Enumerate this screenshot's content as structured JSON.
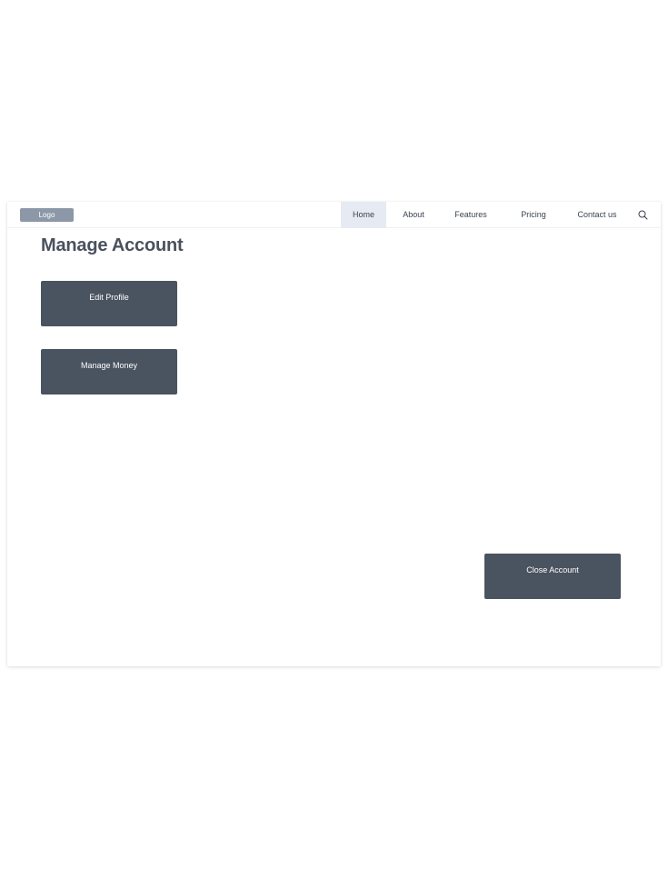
{
  "navbar": {
    "logo": "Logo",
    "items": [
      {
        "label": "Home",
        "active": true
      },
      {
        "label": "About",
        "active": false
      },
      {
        "label": "Features",
        "active": false
      },
      {
        "label": "Pricing",
        "active": false
      },
      {
        "label": "Contact us",
        "active": false
      }
    ],
    "search_icon": "search-icon"
  },
  "page": {
    "title": "Manage Account"
  },
  "actions": {
    "edit_profile": "Edit Profile",
    "manage_money": "Manage Money",
    "close_account": "Close Account"
  },
  "colors": {
    "button_bg": "#4a5360",
    "logo_bg": "#8c97a8",
    "active_nav_bg": "#e6eaf2",
    "title_text": "#4a515e"
  }
}
